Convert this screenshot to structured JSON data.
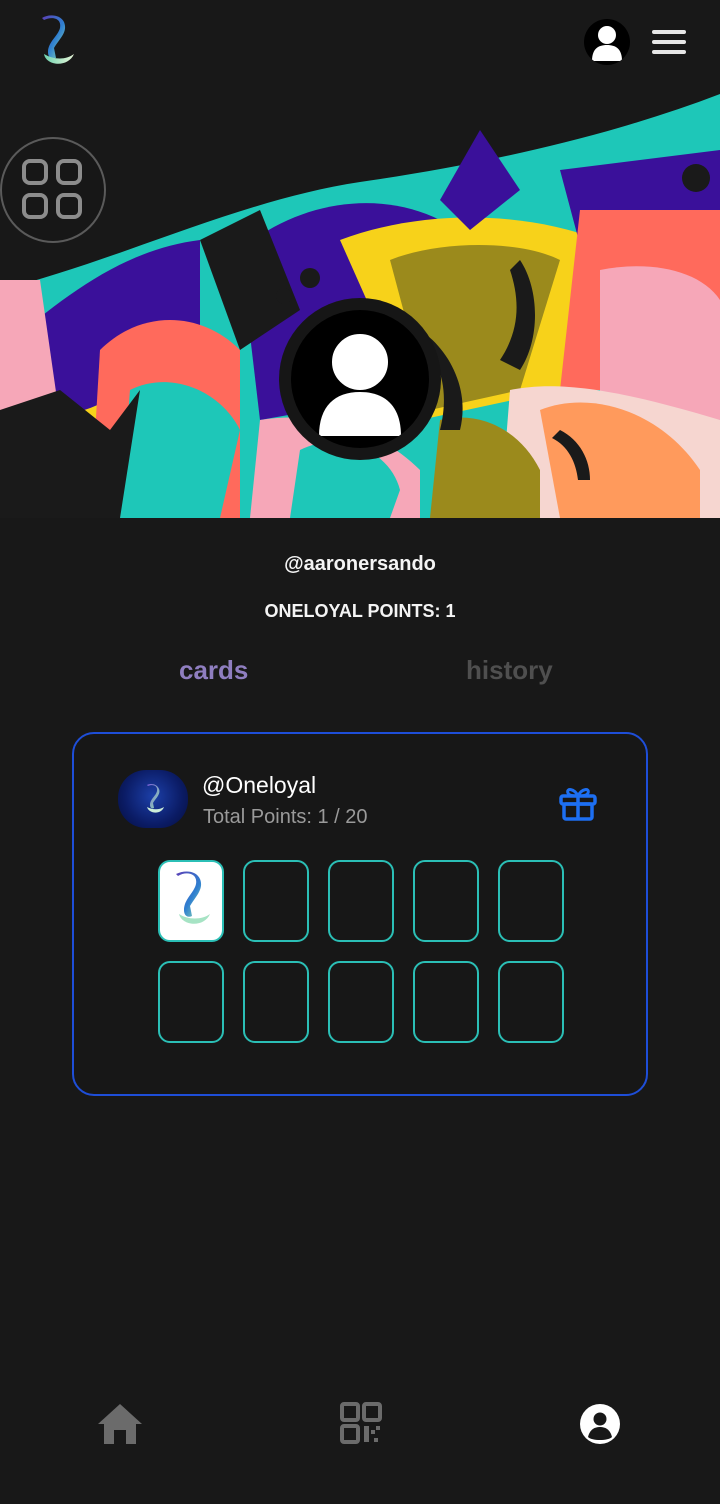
{
  "header": {
    "logo_icon": "oneloyal-logo-icon",
    "avatar_icon": "user-avatar-icon",
    "menu_icon": "hamburger-menu-icon"
  },
  "banner": {
    "grid_icon": "apps-grid-icon"
  },
  "profile": {
    "username": "@aaronersando",
    "points_label": "ONELOYAL POINTS: 1"
  },
  "tabs": [
    {
      "label": "cards",
      "active": true
    },
    {
      "label": "history",
      "active": false
    }
  ],
  "loyalty_card": {
    "merchant_name": "@Oneloyal",
    "total_points": "Total Points: 1 / 20",
    "stamps_collected": 1,
    "stamps_visible": 10,
    "reward_icon": "gift-icon"
  },
  "bottom_nav": [
    {
      "name": "home",
      "icon": "home-icon"
    },
    {
      "name": "scan",
      "icon": "qr-code-icon"
    },
    {
      "name": "profile",
      "icon": "profile-icon"
    }
  ],
  "colors": {
    "background": "#181818",
    "accent_tab": "#8f7ec0",
    "inactive_tab": "#4f4f4f",
    "card_border": "#1e4ed8",
    "stamp_border": "#2bbfb6",
    "gift": "#1d6ff2"
  }
}
